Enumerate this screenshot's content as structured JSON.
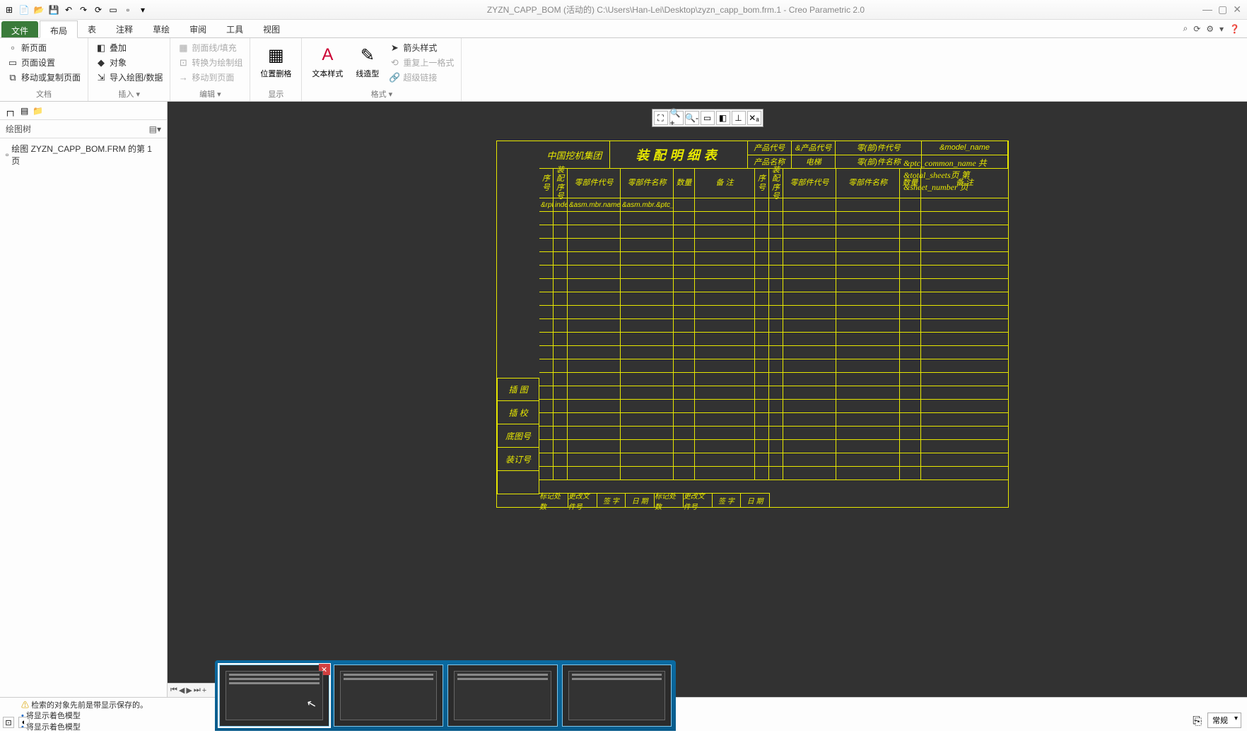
{
  "titlebar": {
    "title": "ZYZN_CAPP_BOM (活动的) C:\\Users\\Han-Lei\\Desktop\\zyzn_capp_bom.frm.1 - Creo Parametric 2.0"
  },
  "menu": {
    "file": "文件",
    "tabs": [
      "布局",
      "表",
      "注释",
      "草绘",
      "审阅",
      "工具",
      "视图"
    ],
    "active": 0
  },
  "ribbon": {
    "p1": {
      "label": "文档",
      "items": [
        "新页面",
        "页面设置",
        "移动或复制页面"
      ]
    },
    "p2": {
      "label": "插入 ▾",
      "items": [
        "叠加",
        "对象",
        "导入绘图/数据"
      ]
    },
    "p3": {
      "label": "编辑 ▾",
      "items": [
        "剖面线/填充",
        "转换为绘制组",
        "移动到页面"
      ]
    },
    "p4": {
      "label": "显示",
      "big": "位置删格"
    },
    "p5": {
      "label": "格式 ▾",
      "big1": "文本样式",
      "big2": "线造型",
      "items": [
        "箭头样式",
        "重复上一格式",
        "超级链接"
      ]
    }
  },
  "sidebar": {
    "header": "绘图树",
    "item": "绘图 ZYZN_CAPP_BOM.FRM 的第 1 页"
  },
  "drawing": {
    "company": "中国挖机集团",
    "title": "装配明细表",
    "hdr": {
      "prod_code_lbl": "产品代号",
      "prod_code_val": "&产品代号",
      "prod_name_lbl": "产品名称",
      "prod_name_val": "电梯",
      "comp_code_lbl": "零(部)件代号",
      "comp_code_val": "&model_name",
      "comp_name_lbl": "零(部)件名称"
    },
    "overflow": "&ptc_common_name   共&total_sheets页   第&sheet_number 页",
    "cols": [
      "序号",
      "装配序号",
      "零部件代号",
      "零部件名称",
      "数量",
      "备    注",
      "序号",
      "装配序号",
      "零部件代号",
      "零部件名称",
      "数量",
      "备    注"
    ],
    "first_row": [
      "&rpt",
      "index",
      "&asm.mbr.name",
      "&asm.mbr.&ptc_common_name",
      "",
      ""
    ],
    "left_labels": [
      "插  图",
      "插  校",
      "底图号",
      "装订号",
      ""
    ],
    "bottom": [
      "标记处数",
      "更改文件号",
      "签  字",
      "日  期",
      "标记处数",
      "更改文件号",
      "签  字",
      "日  期"
    ]
  },
  "status": {
    "warn": "检索的对象先前是带显示保存的。",
    "info1": "将显示着色模型",
    "info2": "将显示着色模型",
    "mode": "常规"
  }
}
